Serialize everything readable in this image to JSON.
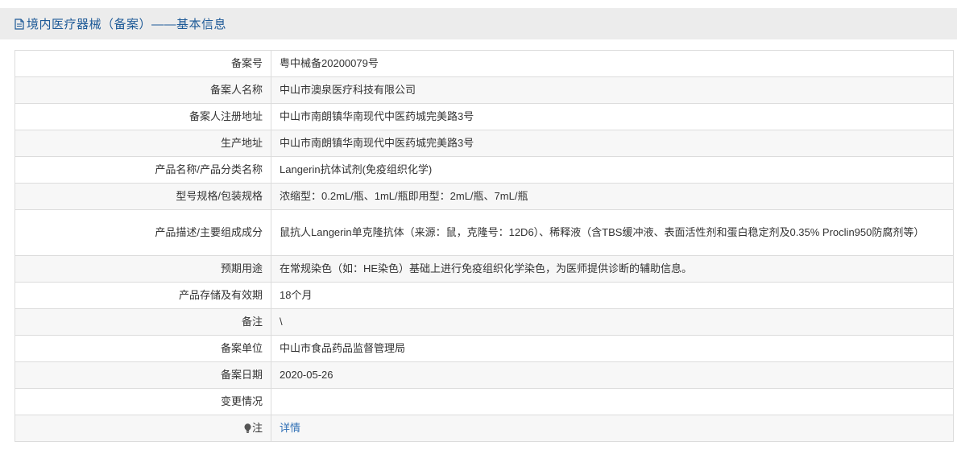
{
  "header": {
    "title": "境内医疗器械（备案）——基本信息",
    "icon": "document-icon"
  },
  "rows": [
    {
      "label": "备案号",
      "value": "粤中械备20200079号"
    },
    {
      "label": "备案人名称",
      "value": "中山市澳泉医疗科技有限公司"
    },
    {
      "label": "备案人注册地址",
      "value": "中山市南朗镇华南现代中医药城完美路3号"
    },
    {
      "label": "生产地址",
      "value": "中山市南朗镇华南现代中医药城完美路3号"
    },
    {
      "label": "产品名称/产品分类名称",
      "value": "Langerin抗体试剂(免疫组织化学)"
    },
    {
      "label": "型号规格/包装规格",
      "value": "浓缩型：0.2mL/瓶、1mL/瓶即用型：2mL/瓶、7mL/瓶"
    },
    {
      "label": "产品描述/主要组成成分",
      "value": "鼠抗人Langerin单克隆抗体（来源：鼠，克隆号：12D6）、稀释液（含TBS缓冲液、表面活性剂和蛋白稳定剂及0.35% Proclin950防腐剂等）"
    },
    {
      "label": "预期用途",
      "value": "在常规染色（如：HE染色）基础上进行免疫组织化学染色，为医师提供诊断的辅助信息。"
    },
    {
      "label": "产品存储及有效期",
      "value": "18个月"
    },
    {
      "label": "备注",
      "value": "\\"
    },
    {
      "label": "备案单位",
      "value": "中山市食品药品监督管理局"
    },
    {
      "label": "备案日期",
      "value": "2020-05-26"
    },
    {
      "label": "变更情况",
      "value": ""
    }
  ],
  "note": {
    "label": "注",
    "icon": "lightbulb-icon",
    "link_text": "详情"
  }
}
